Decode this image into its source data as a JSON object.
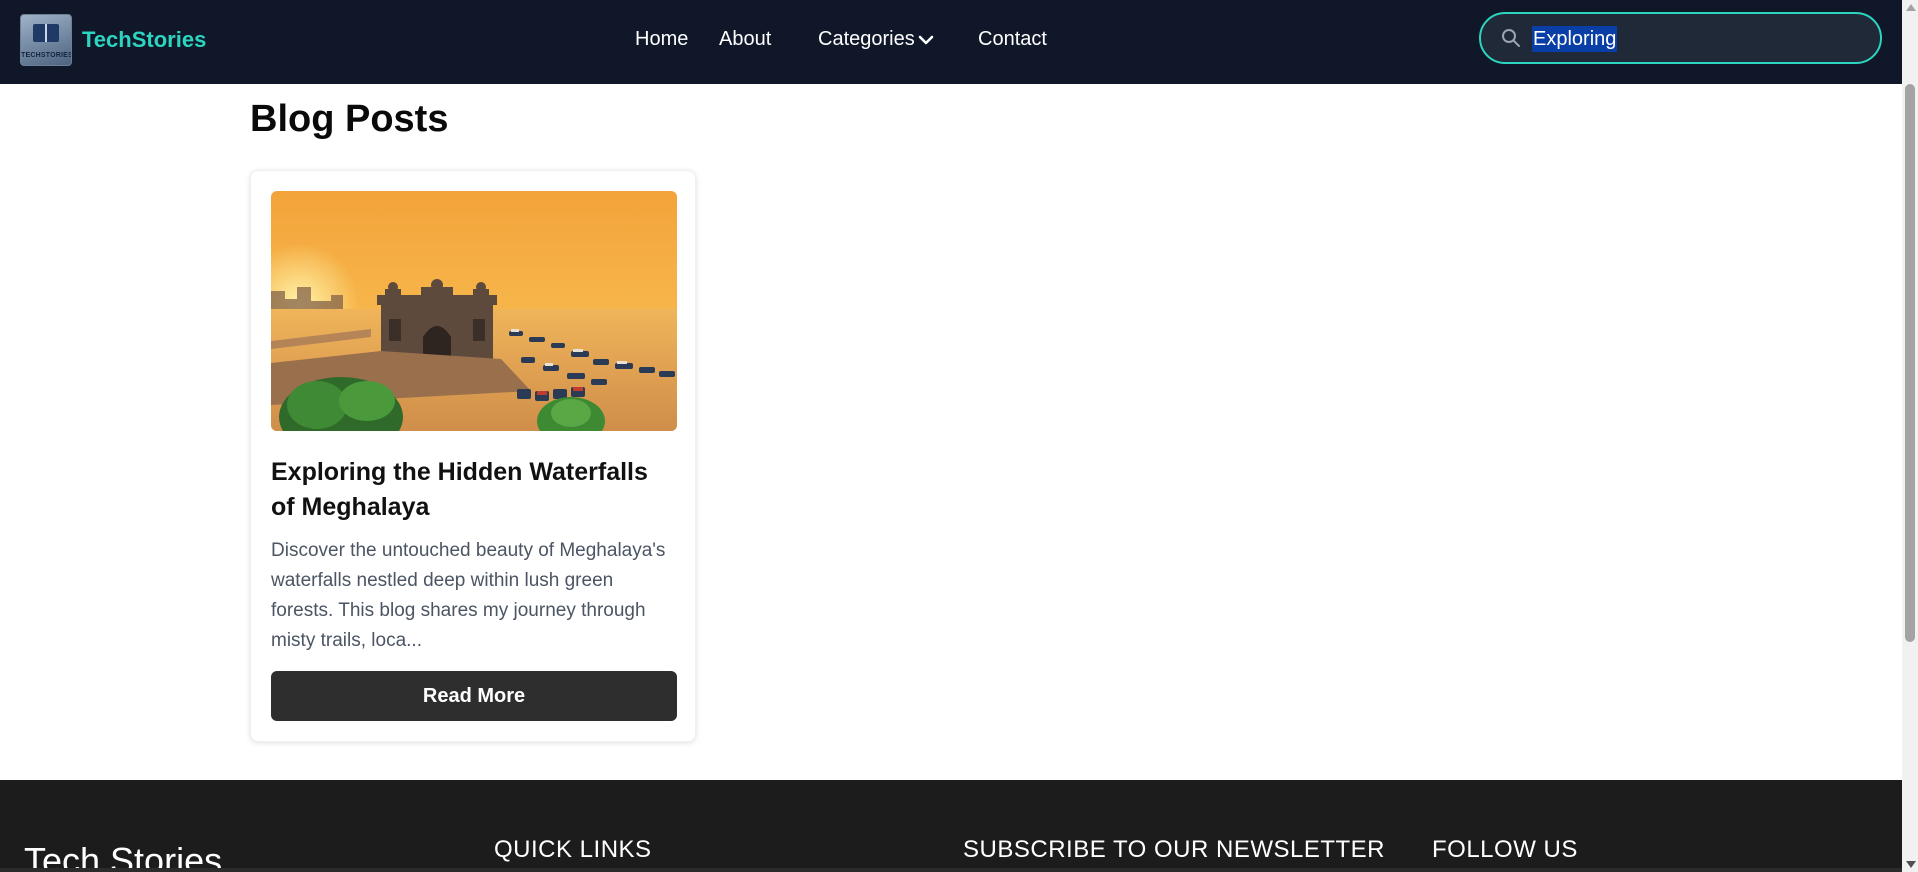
{
  "header": {
    "brand": "TechStories",
    "logo_text": "TECHSTORIES",
    "nav": [
      {
        "label": "Home"
      },
      {
        "label": "About"
      },
      {
        "label": "Categories"
      },
      {
        "label": "Contact"
      }
    ],
    "search": {
      "value": "Exploring",
      "icon": "search-icon"
    }
  },
  "main": {
    "title": "Blog Posts",
    "posts": [
      {
        "title": "Exploring the Hidden Waterfalls of Meghalaya",
        "excerpt": "Discover the untouched beauty of Meghalaya's waterfalls nestled deep within lush green forests. This blog shares my journey through misty trails, loca...",
        "button": "Read More"
      }
    ]
  },
  "footer": {
    "brand": "Tech Stories",
    "quick_links": "QUICK LINKS",
    "newsletter": "SUBSCRIBE TO OUR NEWSLETTER",
    "follow": "FOLLOW US"
  },
  "colors": {
    "header_bg": "#0f1729",
    "accent": "#2dd4bf",
    "button_bg": "#2e2e2e",
    "footer_bg": "#1c1c1c"
  }
}
